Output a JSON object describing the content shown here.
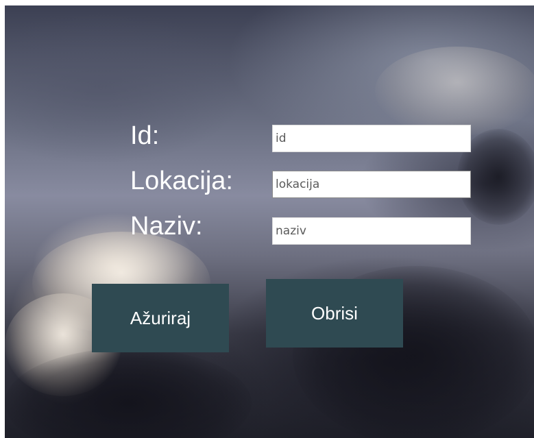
{
  "form": {
    "id_label": "Id:",
    "lokacija_label": "Lokacija:",
    "naziv_label": "Naziv:",
    "id_placeholder": "id",
    "lokacija_placeholder": "lokacija",
    "naziv_placeholder": "naziv",
    "id_value": "",
    "lokacija_value": "",
    "naziv_value": ""
  },
  "buttons": {
    "update_label": "Ažuriraj",
    "delete_label": "Obrisi"
  },
  "colors": {
    "button_bg": "#2f4a52",
    "label_text": "#ffffff",
    "input_bg": "#ffffff"
  },
  "background": {
    "type": "stormy-cloud-sky-photo"
  }
}
